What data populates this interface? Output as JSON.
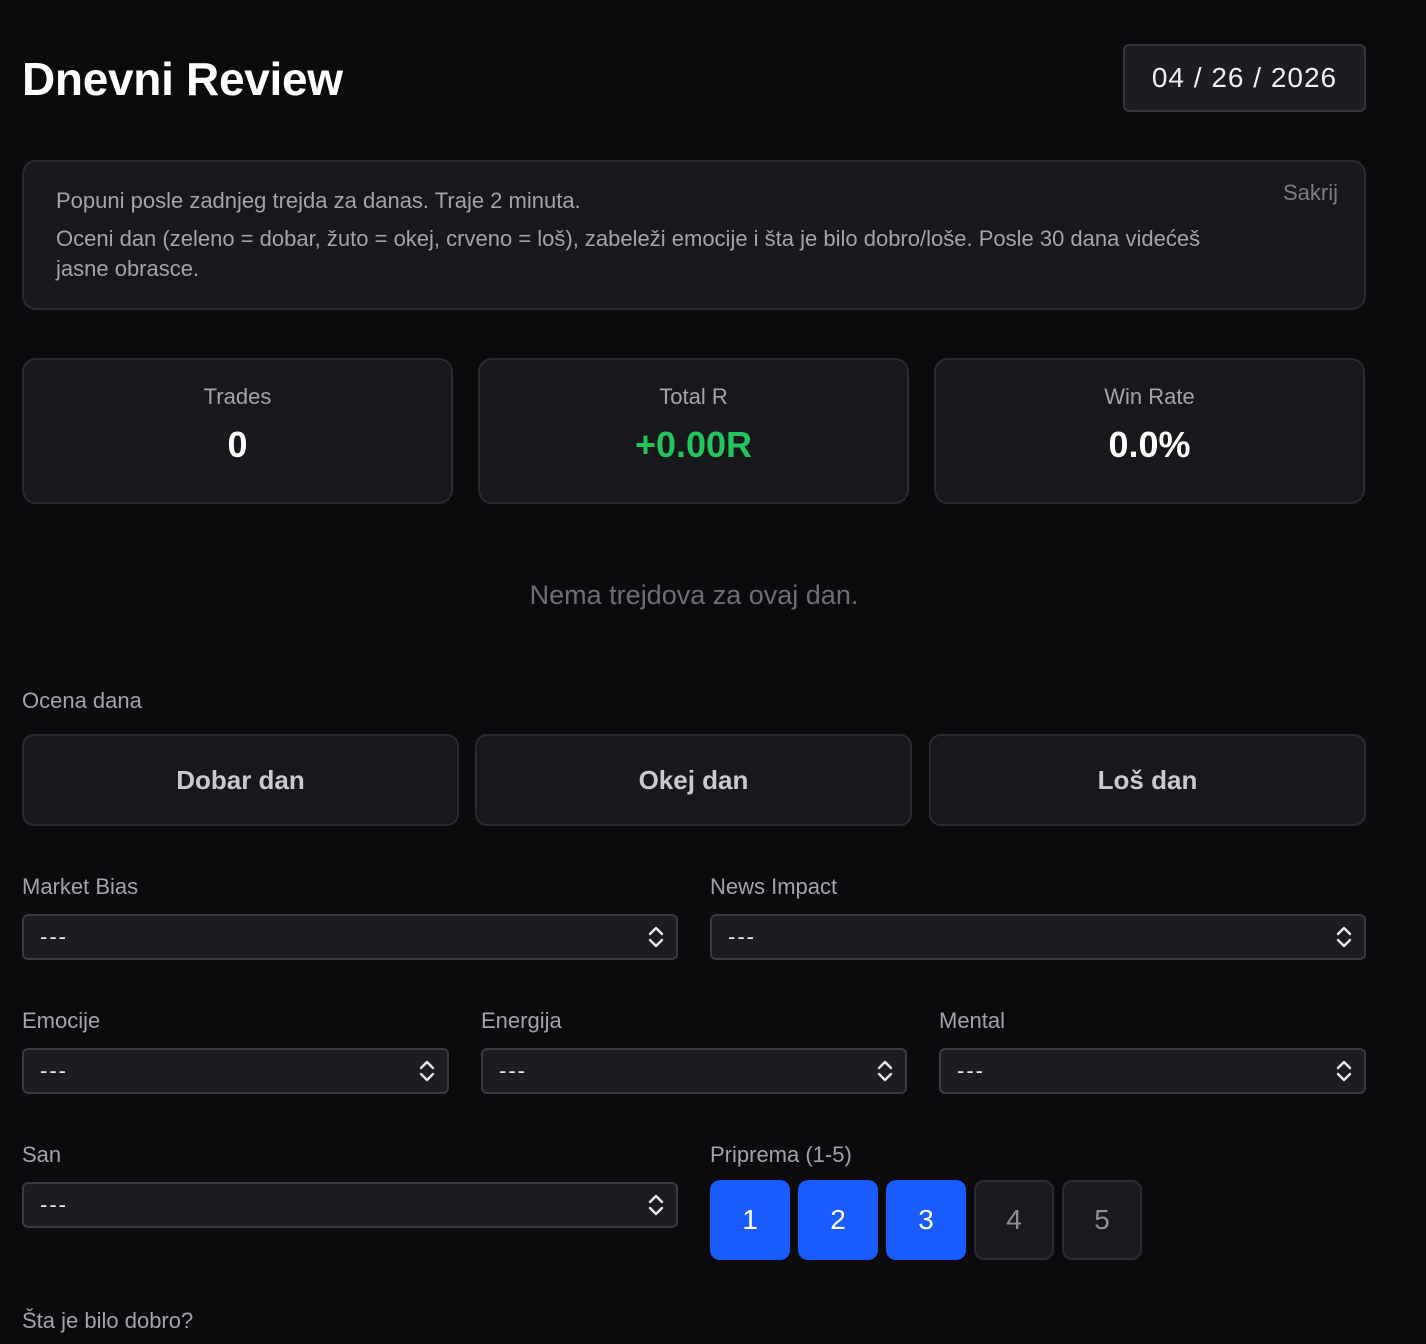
{
  "header": {
    "title": "Dnevni Review",
    "date": "04 / 26 / 2026"
  },
  "info": {
    "line1": "Popuni posle zadnjeg trejda za danas. Traje 2 minuta.",
    "line2": "Oceni dan (zeleno = dobar, žuto = okej, crveno = loš), zabeleži emocije i šta je bilo dobro/loše. Posle 30 dana videćeš jasne obrasce.",
    "hide": "Sakrij"
  },
  "stats": [
    {
      "label": "Trades",
      "value": "0"
    },
    {
      "label": "Total R",
      "value": "+0.00R"
    },
    {
      "label": "Win Rate",
      "value": "0.0%"
    }
  ],
  "empty_message": "Nema trejdova za ovaj dan.",
  "rating": {
    "label": "Ocena dana",
    "options": [
      "Dobar dan",
      "Okej dan",
      "Loš dan"
    ]
  },
  "fields": {
    "market_bias": {
      "label": "Market Bias",
      "value": "---"
    },
    "news_impact": {
      "label": "News Impact",
      "value": "---"
    },
    "emocije": {
      "label": "Emocije",
      "value": "---"
    },
    "energija": {
      "label": "Energija",
      "value": "---"
    },
    "mental": {
      "label": "Mental",
      "value": "---"
    },
    "san": {
      "label": "San",
      "value": "---"
    }
  },
  "priprema": {
    "label": "Priprema (1-5)",
    "options": [
      "1",
      "2",
      "3",
      "4",
      "5"
    ],
    "selected": 3
  },
  "good_question": "Šta je bilo dobro?",
  "colors": {
    "accent": "#1a5cff",
    "positive": "#22c55e",
    "background": "#0b0b0e",
    "card": "#18181c"
  }
}
